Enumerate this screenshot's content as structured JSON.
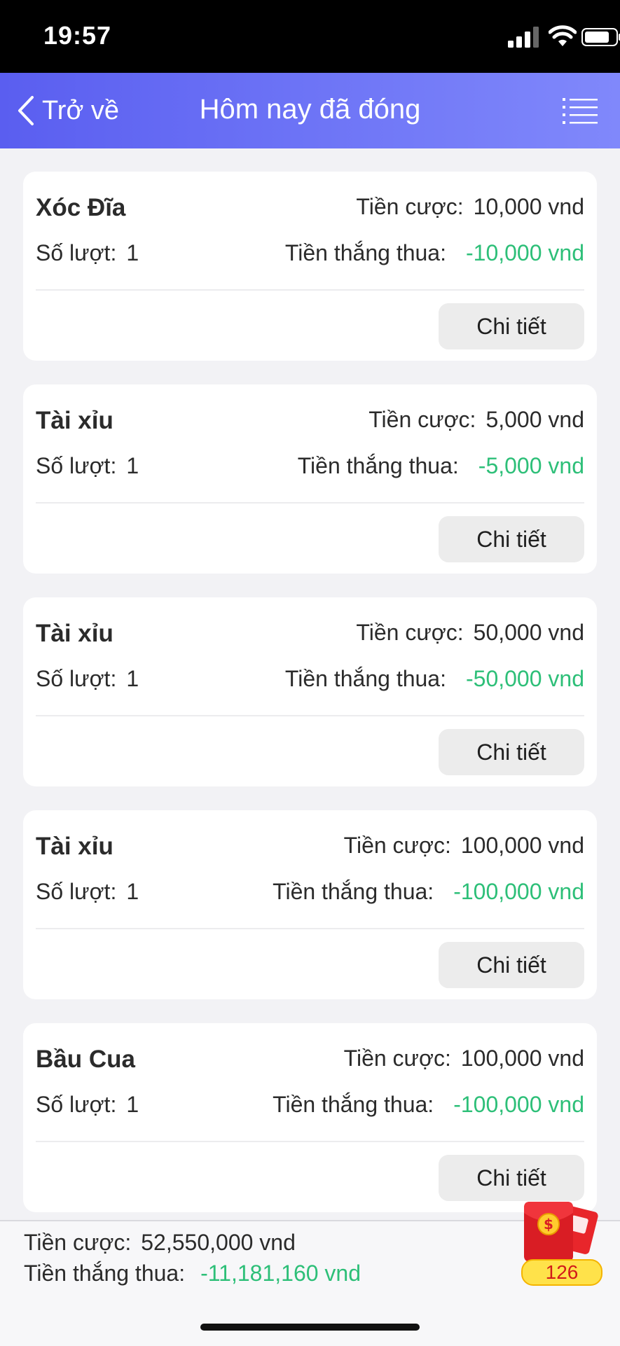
{
  "status_bar": {
    "time": "19:57"
  },
  "nav": {
    "back_label": "Trở về",
    "title": "Hôm nay đã đóng"
  },
  "records": [
    {
      "game": "Xóc Đĩa",
      "bet_label": "Tiền cược:",
      "bet": "10,000 vnd",
      "count_label": "Số lượt:",
      "count": "1",
      "result_label": "Tiền thắng thua:",
      "result": "-10,000 vnd",
      "detail_label": "Chi tiết"
    },
    {
      "game": "Tài xỉu",
      "bet_label": "Tiền cược:",
      "bet": "5,000 vnd",
      "count_label": "Số lượt:",
      "count": "1",
      "result_label": "Tiền thắng thua:",
      "result": "-5,000 vnd",
      "detail_label": "Chi tiết"
    },
    {
      "game": "Tài xỉu",
      "bet_label": "Tiền cược:",
      "bet": "50,000 vnd",
      "count_label": "Số lượt:",
      "count": "1",
      "result_label": "Tiền thắng thua:",
      "result": "-50,000 vnd",
      "detail_label": "Chi tiết"
    },
    {
      "game": "Tài xỉu",
      "bet_label": "Tiền cược:",
      "bet": "100,000 vnd",
      "count_label": "Số lượt:",
      "count": "1",
      "result_label": "Tiền thắng thua:",
      "result": "-100,000 vnd",
      "detail_label": "Chi tiết"
    },
    {
      "game": "Bầu Cua",
      "bet_label": "Tiền cược:",
      "bet": "100,000 vnd",
      "count_label": "Số lượt:",
      "count": "1",
      "result_label": "Tiền thắng thua:",
      "result": "-100,000 vnd",
      "detail_label": "Chi tiết"
    }
  ],
  "footer": {
    "bet_label": "Tiền cược:",
    "bet": "52,550,000 vnd",
    "result_label": "Tiền thắng thua:",
    "result": "-11,181,160 vnd"
  },
  "red_envelope": {
    "icon": "red-envelope-icon",
    "count": "126"
  },
  "colors": {
    "accent_start": "#5a5ef0",
    "accent_end": "#8088fb",
    "negative": "#2dbf78"
  }
}
